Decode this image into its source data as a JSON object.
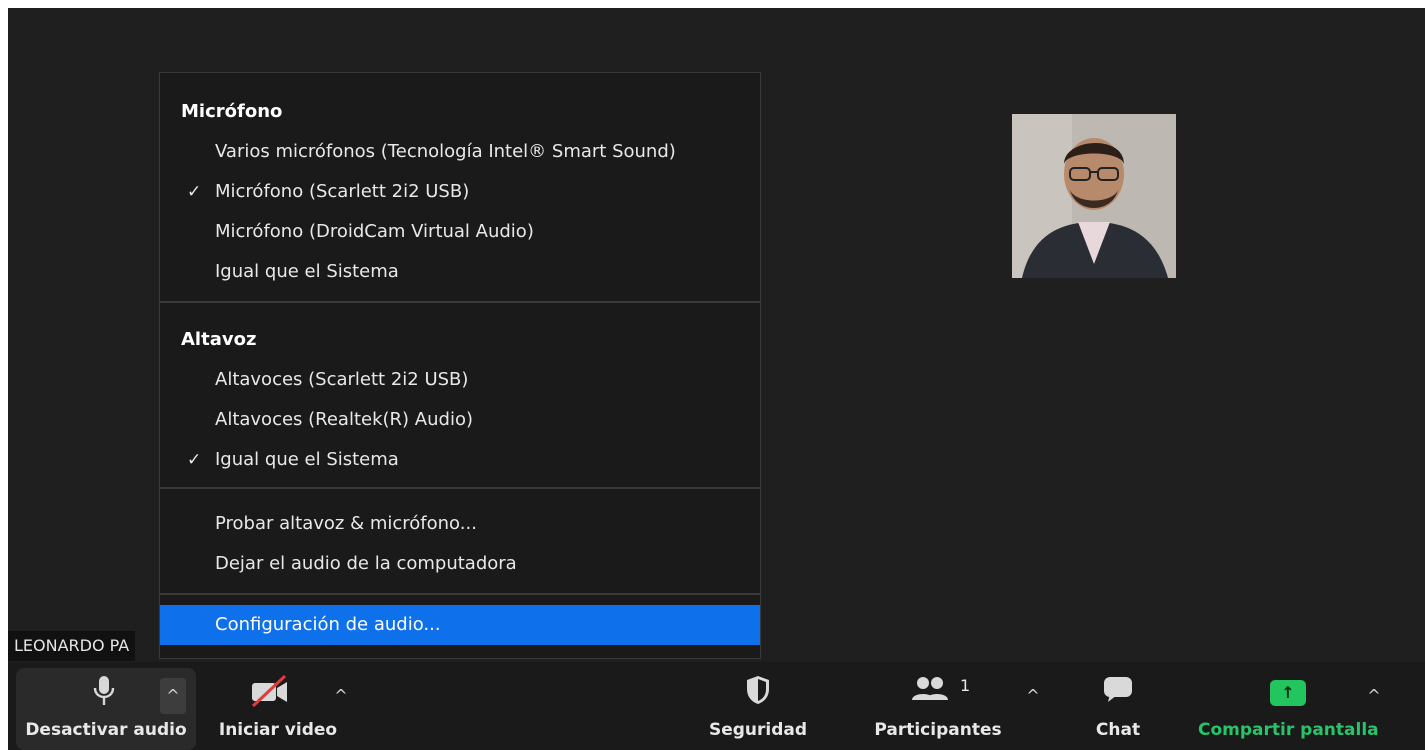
{
  "participant": {
    "name_tag": "LEONARDO PA"
  },
  "menu": {
    "microphone_title": "Micrófono",
    "microphones": [
      {
        "label": "Varios micrófonos (Tecnología Intel® Smart Sound)",
        "checked": false
      },
      {
        "label": "Micrófono (Scarlett 2i2 USB)",
        "checked": true
      },
      {
        "label": "Micrófono (DroidCam Virtual Audio)",
        "checked": false
      },
      {
        "label": "Igual que el Sistema",
        "checked": false
      }
    ],
    "speaker_title": "Altavoz",
    "speakers": [
      {
        "label": "Altavoces (Scarlett 2i2 USB)",
        "checked": false
      },
      {
        "label": "Altavoces (Realtek(R) Audio)",
        "checked": false
      },
      {
        "label": "Igual que el Sistema",
        "checked": true
      }
    ],
    "actions": [
      {
        "label": "Probar altavoz & micrófono..."
      },
      {
        "label": "Dejar el audio de la computadora"
      }
    ],
    "settings_label": "Configuración de audio...",
    "check_glyph": "✓"
  },
  "toolbar": {
    "mute_label": "Desactivar audio",
    "video_label": "Iniciar video",
    "security_label": "Seguridad",
    "participants_label": "Participantes",
    "participants_count": "1",
    "chat_label": "Chat",
    "share_label": "Compartir pantalla",
    "caret_glyph": "^",
    "share_arrow": "↑",
    "colors": {
      "share_green": "#22c55e",
      "highlight_blue": "#0e71eb"
    }
  }
}
